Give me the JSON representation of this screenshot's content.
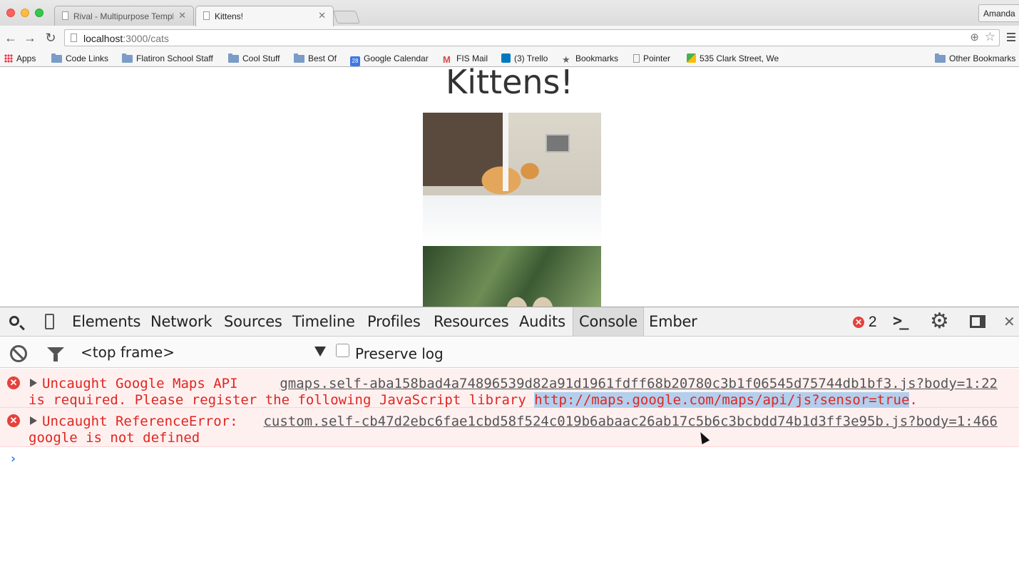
{
  "browser": {
    "tabs": [
      {
        "title": "Rival - Multipurpose Templ"
      },
      {
        "title": "Kittens!"
      }
    ],
    "profile_name": "Amanda",
    "url_host": "localhost",
    "url_path": ":3000/cats",
    "bookmarks": [
      {
        "label": "Apps"
      },
      {
        "label": "Code Links"
      },
      {
        "label": "Flatiron School Staff"
      },
      {
        "label": "Cool Stuff"
      },
      {
        "label": "Best Of"
      },
      {
        "label": "Google Calendar",
        "badge": "28"
      },
      {
        "label": "FIS Mail",
        "badge": "M"
      },
      {
        "label": "(3) Trello"
      },
      {
        "label": "Bookmarks"
      },
      {
        "label": "Pointer"
      },
      {
        "label": "535 Clark Street, We"
      },
      {
        "label": "Other Bookmarks"
      }
    ]
  },
  "page": {
    "title": "Kittens!"
  },
  "devtools": {
    "tabs": [
      "Elements",
      "Network",
      "Sources",
      "Timeline",
      "Profiles",
      "Resources",
      "Audits",
      "Console",
      "Ember"
    ],
    "selected_tab": "Console",
    "error_count": "2",
    "frame": "<top frame>",
    "preserve_log_label": "Preserve log",
    "messages": [
      {
        "line1": "Uncaught Google Maps API",
        "line2_text": "is required. Please register the following JavaScript library ",
        "line2_link": "http://maps.google.com/maps/api/js?sensor=true",
        "line2_end": ".",
        "source": "gmaps.self-aba158bad4a74896539d82a91d1961fdff68b20780c3b1f06545d75744db1bf3.js?body=1:22"
      },
      {
        "line1": "Uncaught ReferenceError:",
        "line2_text": "google is not defined",
        "source": "custom.self-cb47d2ebc6fae1cbd58f524c019b6abaac26ab17c5b6c3bcbdd74b1d3ff3e95b.js?body=1:466"
      }
    ]
  },
  "colors": {
    "error_red": "#e0261f",
    "link_blue": "#367cf1"
  }
}
